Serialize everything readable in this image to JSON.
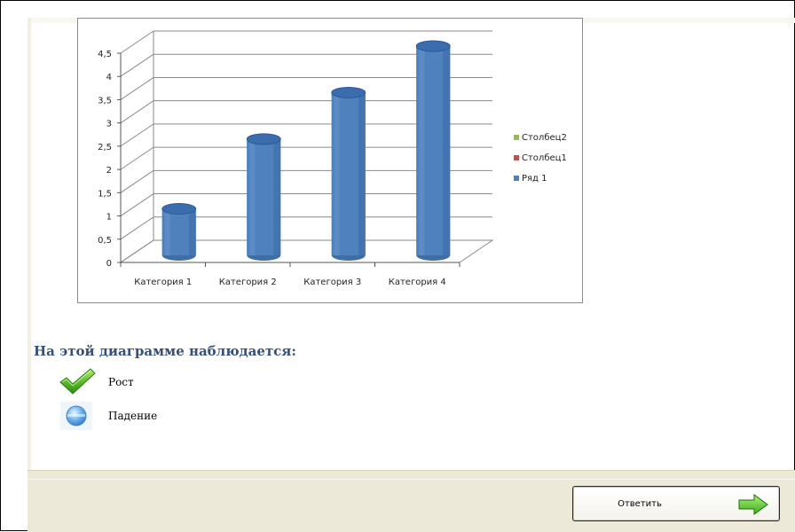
{
  "chart_data": {
    "type": "bar",
    "categories": [
      "Категория 1",
      "Категория 2",
      "Категория 3",
      "Категория 4"
    ],
    "series": [
      {
        "name": "Ряд 1",
        "values": [
          1,
          2.5,
          3.5,
          4.5
        ],
        "color": "#4f81bd"
      },
      {
        "name": "Столбец1",
        "values": [],
        "color": "#c0504d"
      },
      {
        "name": "Столбец2",
        "values": [],
        "color": "#9bbb59"
      }
    ],
    "y_ticks": [
      "0",
      "0,5",
      "1",
      "1,5",
      "2",
      "2,5",
      "3",
      "3,5",
      "4",
      "4,5"
    ],
    "ylim": [
      0,
      4.5
    ],
    "legend_order": [
      "Столбец2",
      "Столбец1",
      "Ряд 1"
    ],
    "legend_placement": "right",
    "grid": true,
    "style": "3d-cylinder"
  },
  "question": {
    "text": "На этой диаграмме наблюдается:"
  },
  "options": [
    {
      "label": "Рост",
      "icon": "green-checkmark-icon",
      "selected": true
    },
    {
      "label": "Падение",
      "icon": "blue-radio-icon",
      "selected": false
    }
  ],
  "footer": {
    "submit_label": "Ответить",
    "submit_icon": "green-arrow-right-icon"
  },
  "colors": {
    "question_text": "#35507a",
    "footer_bg": "#ece9d8",
    "bar": "#4f81bd"
  }
}
